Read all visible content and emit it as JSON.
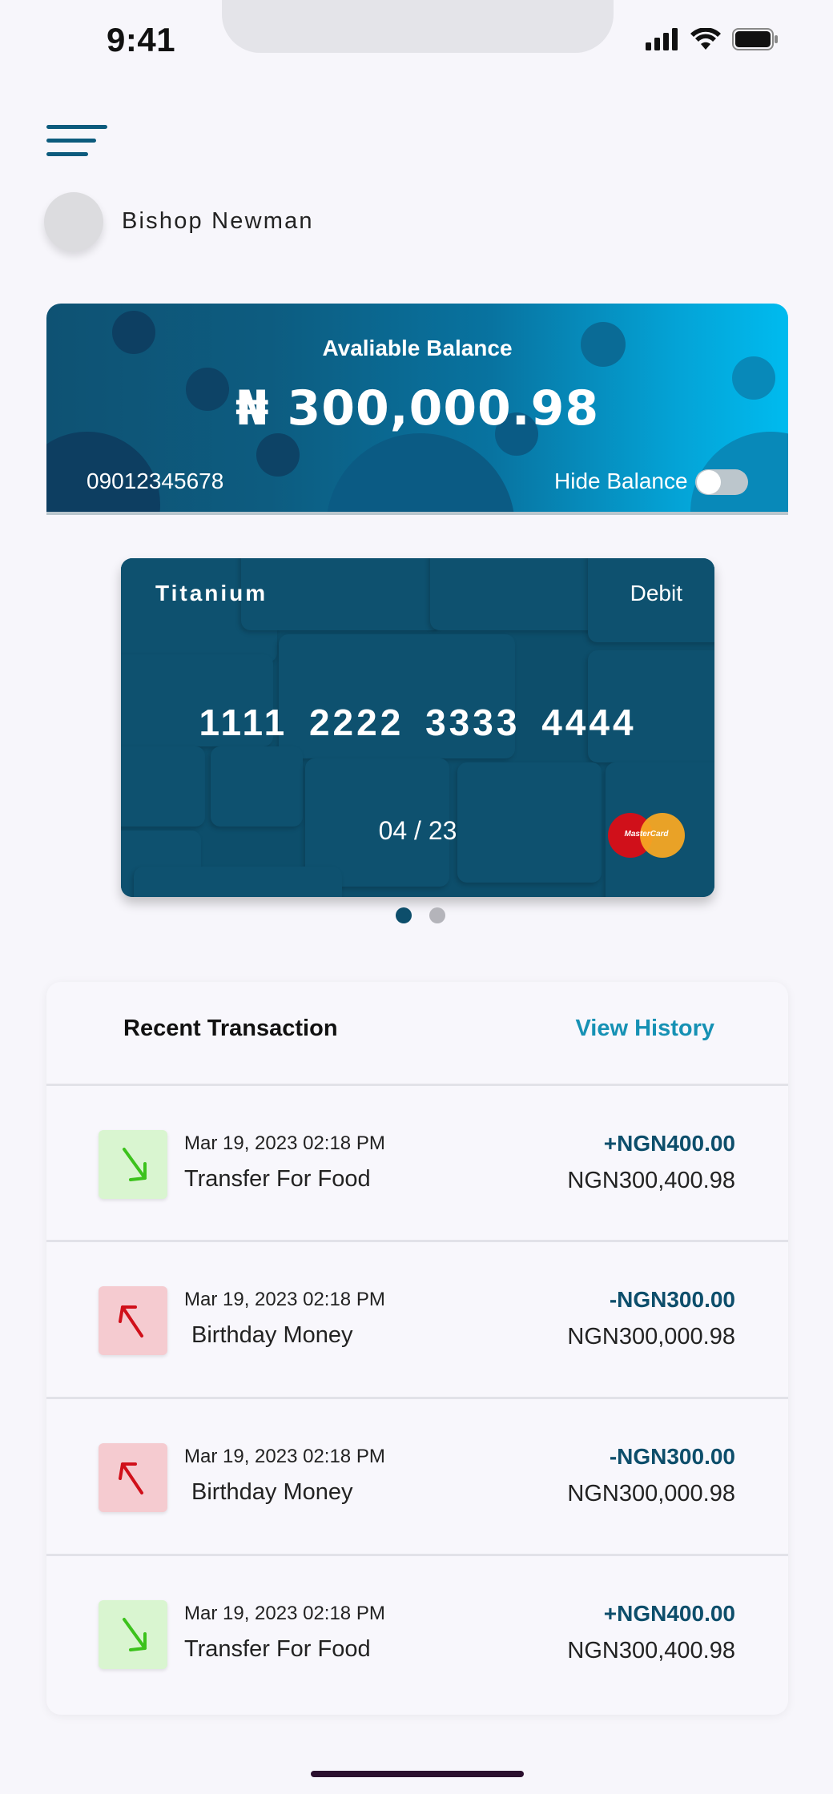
{
  "status_bar": {
    "time": "9:41"
  },
  "user": {
    "name": "Bishop Newman"
  },
  "balance_card": {
    "label": "Avaliable Balance",
    "amount": "₦ 300,000.98",
    "account_number": "09012345678",
    "hide_balance_label": "Hide Balance",
    "hide_balance_on": false
  },
  "debit_card": {
    "brand": "Titanium",
    "type": "Debit",
    "number": "1111  2222  3333  4444",
    "expiry": "04 / 23",
    "network_logo_text": "MasterCard"
  },
  "carousel": {
    "active_index": 0,
    "count": 2
  },
  "transactions": {
    "title": "Recent Transaction",
    "view_history_label": "View History",
    "items": [
      {
        "direction": "in",
        "icon": "arrow-down-icon",
        "date": "Mar 19, 2023 02:18 PM",
        "description": "Transfer For Food",
        "amount": "+NGN400.00",
        "balance": "NGN300,400.98"
      },
      {
        "direction": "out",
        "icon": "arrow-up-icon",
        "date": "Mar 19, 2023 02:18 PM",
        "description": "Birthday Money",
        "amount": "-NGN300.00",
        "balance": "NGN300,000.98"
      },
      {
        "direction": "out",
        "icon": "arrow-up-icon",
        "date": "Mar 19, 2023 02:18 PM",
        "description": "Birthday Money",
        "amount": "-NGN300.00",
        "balance": "NGN300,000.98"
      },
      {
        "direction": "in",
        "icon": "arrow-down-icon",
        "date": "Mar 19, 2023 02:18 PM",
        "description": "Transfer For Food",
        "amount": "+NGN400.00",
        "balance": "NGN300,400.98"
      }
    ]
  },
  "colors": {
    "brand_dark": "#0d4e6b",
    "brand_accent": "#1691b4",
    "credit_bg": "#d9f5d0",
    "credit_arrow": "#3cc21c",
    "debit_bg": "#f5cbd0",
    "debit_arrow": "#d0101a"
  }
}
